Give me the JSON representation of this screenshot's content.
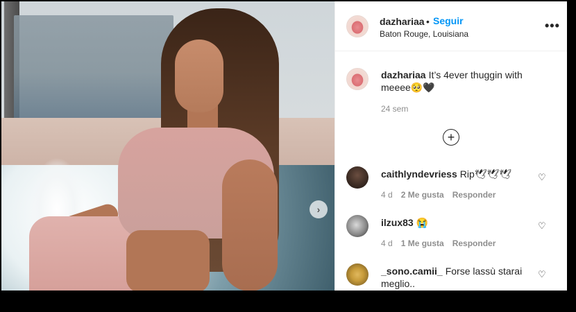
{
  "post": {
    "username": "dazhariaa",
    "separator": "•",
    "follow_label": "Seguir",
    "location": "Baton Rouge, Louisiana",
    "more_label": "•••",
    "caption_user": "dazhariaa",
    "caption_text": "It’s 4ever thuggin with meeee🥺🖤",
    "caption_time": "24 sem",
    "next_label": "›",
    "load_more_label": "+"
  },
  "comments": [
    {
      "user": "caithlyndevriess",
      "text": "Rip🕊🕊🕊",
      "age": "4 d",
      "likes": "2 Me gusta",
      "reply": "Responder"
    },
    {
      "user": "ilzux83",
      "text": "😭",
      "age": "4 d",
      "likes": "1 Me gusta",
      "reply": "Responder"
    },
    {
      "user": "_sono.camii_",
      "text": "Forse lassù starai meglio..",
      "age": "",
      "likes": "",
      "reply": ""
    }
  ],
  "icons": {
    "heart": "♡"
  }
}
